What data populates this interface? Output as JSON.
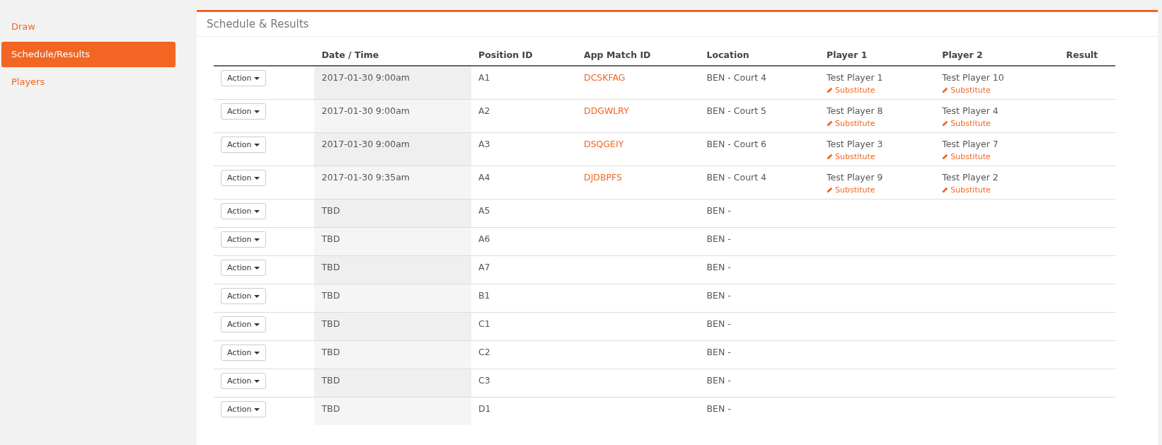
{
  "sidebar": {
    "items": [
      {
        "label": "Draw",
        "selected": false
      },
      {
        "label": "Schedule/Results",
        "selected": true
      },
      {
        "label": "Players",
        "selected": false
      }
    ]
  },
  "panel": {
    "title": "Schedule & Results",
    "table": {
      "columns": [
        "Date / Time",
        "Position ID",
        "App Match ID",
        "Location",
        "Player 1",
        "Player 2",
        "Result"
      ],
      "rows": [
        {
          "action": "Action",
          "date_time": "2017-01-30 9:00am",
          "position_id": "A1",
          "app_match_id": "DCSKFAG",
          "location": "BEN - Court 4",
          "player_1": {
            "name": "Test Player 1",
            "link": "Substitute"
          },
          "player_2": {
            "name": "Test Player 10",
            "link": "Substitute"
          }
        },
        {
          "action": "Action",
          "date_time": "2017-01-30 9:00am",
          "position_id": "A2",
          "app_match_id": "DDGWLRY",
          "location": "BEN - Court 5",
          "player_1": {
            "name": "Test Player 8",
            "link": "Substitute"
          },
          "player_2": {
            "name": "Test Player 4",
            "link": "Substitute"
          }
        },
        {
          "action": "Action",
          "date_time": "2017-01-30 9:00am",
          "position_id": "A3",
          "app_match_id": "DSQGEIY",
          "location": "BEN - Court 6",
          "player_1": {
            "name": "Test Player 3",
            "link": "Substitute"
          },
          "player_2": {
            "name": "Test Player 7",
            "link": "Substitute"
          }
        },
        {
          "action": "Action",
          "date_time": "2017-01-30 9:35am",
          "position_id": "A4",
          "app_match_id": "DJDBPFS",
          "location": "BEN - Court 4",
          "player_1": {
            "name": "Test Player 9",
            "link": "Substitute"
          },
          "player_2": {
            "name": "Test Player 2",
            "link": "Substitute"
          }
        },
        {
          "action": "Action",
          "date_time": "TBD",
          "position_id": "A5",
          "location": "BEN -"
        },
        {
          "action": "Action",
          "date_time": "TBD",
          "position_id": "A6",
          "location": "BEN -"
        },
        {
          "action": "Action",
          "date_time": "TBD",
          "position_id": "A7",
          "location": "BEN -"
        },
        {
          "action": "Action",
          "date_time": "TBD",
          "position_id": "B1",
          "location": "BEN -"
        },
        {
          "action": "Action",
          "date_time": "TBD",
          "position_id": "C1",
          "location": "BEN -"
        },
        {
          "action": "Action",
          "date_time": "TBD",
          "position_id": "C2",
          "location": "BEN -"
        },
        {
          "action": "Action",
          "date_time": "TBD",
          "position_id": "C3",
          "location": "BEN -"
        },
        {
          "action": "Action",
          "date_time": "TBD",
          "position_id": "D1",
          "location": "BEN -"
        }
      ]
    }
  }
}
